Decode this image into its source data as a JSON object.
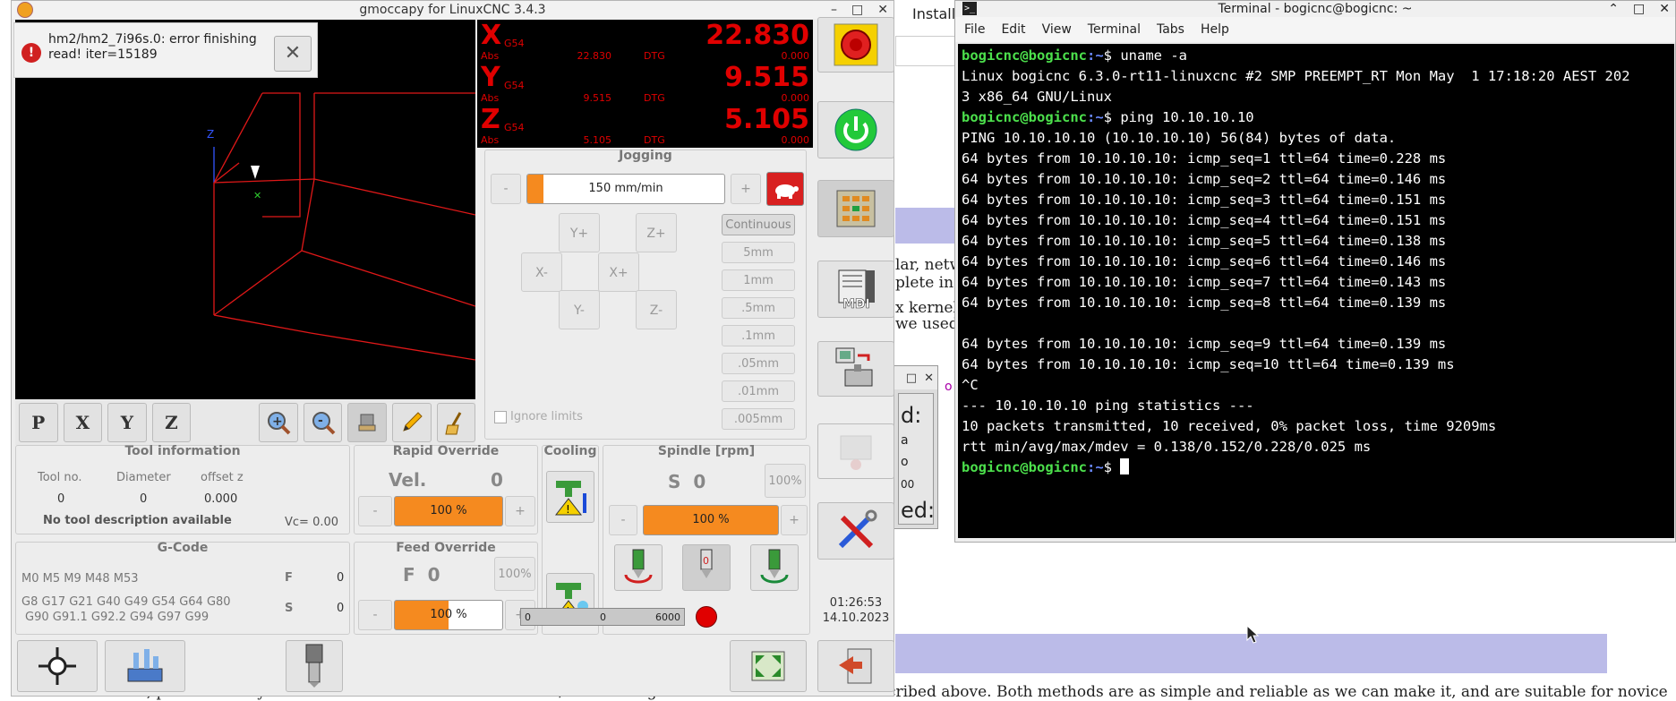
{
  "background": {
    "tab_label": "Installi",
    "line1": "lar, netw",
    "line2": "plete in",
    "line3": "x kernel",
    "line4": "we used",
    "bottom_text": "The easiest, preferred way to install LinuxCNC is to use the Live/Install Image or Debian Bookworm as described above. Both methods are as simple and reliable as we can make it, and are suitable for novice",
    "dialog_lbl1": "d:",
    "dialog_lbl2": "ed:",
    "dialog_lbl3": "a",
    "dialog_lbl4": "o",
    "dialog_lbl5": "00"
  },
  "gmoccapy": {
    "title": "gmoccapy for LinuxCNC  3.4.3",
    "error_message": {
      "line1": "hm2/hm2_7i96s.0: error finishing",
      "line2": "read! iter=15189"
    },
    "preview_toolbar": [
      "P",
      "X",
      "Y",
      "Z"
    ],
    "dro": {
      "x": {
        "axis": "X",
        "coord": "G54",
        "value": "22.830",
        "abs_label": "Abs",
        "abs": "22.830",
        "dtg_label": "DTG",
        "dtg": "0.000"
      },
      "y": {
        "axis": "Y",
        "coord": "G54",
        "value": "9.515",
        "abs_label": "Abs",
        "abs": "9.515",
        "dtg_label": "DTG",
        "dtg": "0.000"
      },
      "z": {
        "axis": "Z",
        "coord": "G54",
        "value": "5.105",
        "abs_label": "Abs",
        "abs": "5.105",
        "dtg_label": "DTG",
        "dtg": "0.000"
      }
    },
    "jogging": {
      "title": "Jogging",
      "minus": "-",
      "plus": "+",
      "speed": "150 mm/min",
      "speed_fraction": 0.08,
      "buttons": {
        "y_plus": "Y+",
        "z_plus": "Z+",
        "x_minus": "X-",
        "x_plus": "X+",
        "y_minus": "Y-",
        "z_minus": "Z-"
      },
      "increments": [
        "Continuous",
        "5mm",
        "1mm",
        ".5mm",
        ".1mm",
        ".05mm",
        ".01mm",
        ".005mm"
      ],
      "ignore_limits": "Ignore limits"
    },
    "tool_info": {
      "title": "Tool information",
      "tool_no_label": "Tool no.",
      "diameter_label": "Diameter",
      "offset_label": "offset z",
      "tool_no": "0",
      "diameter": "0",
      "offset": "0.000",
      "description": "No tool description available",
      "vc": "Vc= 0.00"
    },
    "gcode": {
      "title": "G-Code",
      "mcodes": "M0 M5 M9 M48 M53",
      "gcodes_line1": "G8 G17 G21 G40 G49 G54 G64 G80",
      "gcodes_line2": "G90 G91.1 G92.2 G94 G97 G99",
      "f_label": "F",
      "f_value": "0",
      "s_label": "S",
      "s_value": "0"
    },
    "rapid_override": {
      "title": "Rapid Override",
      "vel_label": "Vel.",
      "vel_value": "0",
      "minus": "-",
      "plus": "+",
      "value": "100 %"
    },
    "feed_override": {
      "title": "Feed Override",
      "label": "F  0",
      "pct_button": "100%",
      "minus": "-",
      "plus": "+",
      "value": "100 %"
    },
    "cooling": {
      "title": "Cooling"
    },
    "spindle": {
      "title": "Spindle [rpm]",
      "label": "S  0",
      "pct_button": "100%",
      "minus": "-",
      "plus": "+",
      "value": "100 %",
      "bar_min": "0",
      "bar_value": "0",
      "bar_max": "6000",
      "fwd_number": "0"
    },
    "mdi_label": "MDI",
    "clock_time": "01:26:53",
    "clock_date": "14.10.2023",
    "colors": {
      "dro_red": "#e00000",
      "override_orange": "#f58a1f",
      "estop_yellow": "#f5d000",
      "power_green": "#22c93a"
    }
  },
  "terminal": {
    "title": "Terminal - bogicnc@bogicnc: ~",
    "menu": [
      "File",
      "Edit",
      "View",
      "Terminal",
      "Tabs",
      "Help"
    ],
    "prompt_user": "bogicnc@bogicnc",
    "prompt_path": ":~",
    "prompt_sign": "$",
    "cmd1": " uname -a",
    "out1a": "Linux bogicnc 6.3.0-rt11-linuxcnc #2 SMP PREEMPT_RT Mon May  1 17:18:20 AEST 202",
    "out1b": "3 x86_64 GNU/Linux",
    "cmd2": " ping 10.10.10.10",
    "ping_header": "PING 10.10.10.10 (10.10.10.10) 56(84) bytes of data.",
    "ping_lines": [
      "64 bytes from 10.10.10.10: icmp_seq=1 ttl=64 time=0.228 ms",
      "64 bytes from 10.10.10.10: icmp_seq=2 ttl=64 time=0.146 ms",
      "64 bytes from 10.10.10.10: icmp_seq=3 ttl=64 time=0.151 ms",
      "64 bytes from 10.10.10.10: icmp_seq=4 ttl=64 time=0.151 ms",
      "64 bytes from 10.10.10.10: icmp_seq=5 ttl=64 time=0.138 ms",
      "64 bytes from 10.10.10.10: icmp_seq=6 ttl=64 time=0.146 ms",
      "64 bytes from 10.10.10.10: icmp_seq=7 ttl=64 time=0.143 ms",
      "64 bytes from 10.10.10.10: icmp_seq=8 ttl=64 time=0.139 ms"
    ],
    "ping_lines_2": [
      "64 bytes from 10.10.10.10: icmp_seq=9 ttl=64 time=0.139 ms",
      "64 bytes from 10.10.10.10: icmp_seq=10 ttl=64 time=0.139 ms"
    ],
    "interrupt": "^C",
    "stats_header": "--- 10.10.10.10 ping statistics ---",
    "stats_line1": "10 packets transmitted, 10 received, 0% packet loss, time 9209ms",
    "stats_line2": "rtt min/avg/max/mdev = 0.138/0.152/0.228/0.025 ms"
  }
}
